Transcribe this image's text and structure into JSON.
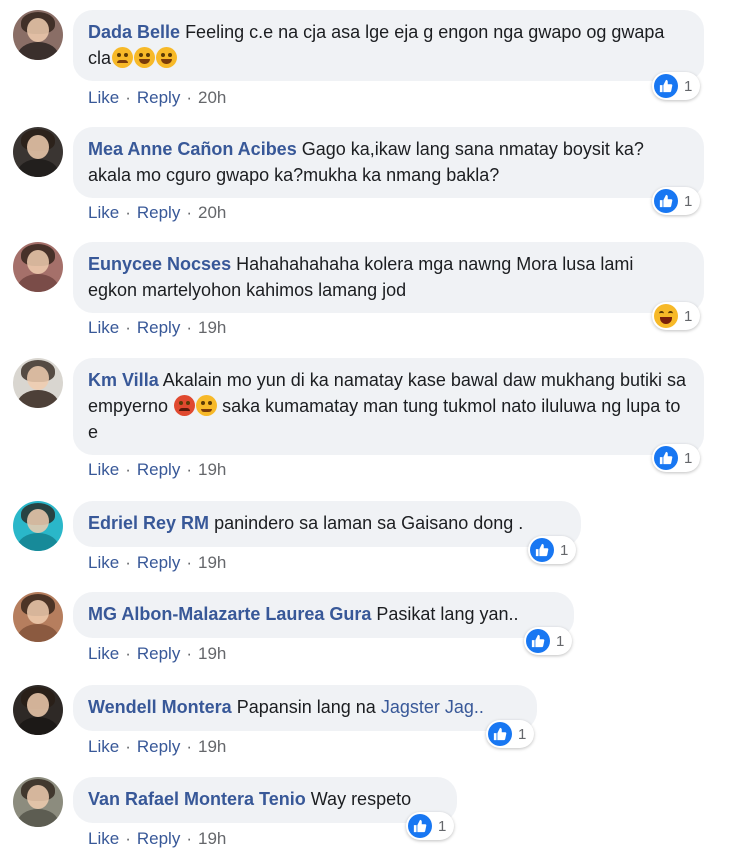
{
  "actions": {
    "like": "Like",
    "reply": "Reply",
    "separator": "·"
  },
  "colors": {
    "author": "#385898",
    "bubble": "#f0f2f5",
    "like_blue": "#1877f2",
    "haha_yellow": "#f7b928"
  },
  "comments": [
    {
      "author": "Dada Belle",
      "text_parts": [
        "Feeling c.e na cja asa lge eja g engon nga gwapo og gwapa cla"
      ],
      "emojis": [
        "worried-face-emoji",
        "laughing-face-emoji",
        "laughing-face-emoji"
      ],
      "time": "20h",
      "reaction": {
        "icon": "like-icon",
        "count": "1"
      },
      "avatar_colors": {
        "bg": "#8a6e66",
        "shirt": "#3a2f2c"
      }
    },
    {
      "author": "Mea Anne Cañon Acibes",
      "text_parts": [
        "Gago ka,ikaw lang sana nmatay boysit ka?akala mo cguro gwapo ka?mukha ka nmang bakla?"
      ],
      "time": "20h",
      "reaction": {
        "icon": "like-icon",
        "count": "1"
      },
      "avatar_colors": {
        "bg": "#3a3532",
        "shirt": "#221f1d"
      }
    },
    {
      "author": "Eunycee Nocses",
      "text_parts": [
        "Hahahahahaha kolera mga nawng Mora lusa lami egkon martelyohon kahimos lamang jod"
      ],
      "time": "19h",
      "reaction": {
        "icon": "haha-icon",
        "count": "1"
      },
      "avatar_colors": {
        "bg": "#a5706a",
        "shirt": "#7a4c48"
      }
    },
    {
      "author": "Km Villa",
      "text_parts": [
        "Akalain mo yun di ka namatay kase bawal daw mukhang butiki sa empyerno",
        "saka kumamatay man tung tukmol nato iluluwa ng lupa to e"
      ],
      "emojis": [
        "angry-face-emoji",
        "smirk-face-emoji"
      ],
      "time": "19h",
      "reaction": {
        "icon": "like-icon",
        "count": "1"
      },
      "avatar_colors": {
        "bg": "#d9d6d0",
        "shirt": "#4d4038"
      }
    },
    {
      "author": "Edriel Rey RM",
      "text_parts": [
        "panindero sa laman sa Gaisano dong ."
      ],
      "time": "19h",
      "reaction": {
        "icon": "like-icon",
        "count": "1"
      },
      "avatar_colors": {
        "bg": "#2ab7c9",
        "shirt": "#178a99"
      }
    },
    {
      "author": "MG Albon-Malazarte Laurea Gura",
      "text_parts": [
        "Pasikat lang yan.."
      ],
      "time": "19h",
      "reaction": {
        "icon": "like-icon",
        "count": "1"
      },
      "avatar_colors": {
        "bg": "#b67e5e",
        "shirt": "#8b5a40"
      }
    },
    {
      "author": "Wendell Montera",
      "text_parts": [
        "Papansin lang na"
      ],
      "mention": "Jagster Jag..",
      "time": "19h",
      "reaction": {
        "icon": "like-icon",
        "count": "1"
      },
      "avatar_colors": {
        "bg": "#2e2926",
        "shirt": "#1c1917"
      }
    },
    {
      "author": "Van Rafael Montera Tenio",
      "text_parts": [
        "Way respeto"
      ],
      "time": "19h",
      "reaction": {
        "icon": "like-icon",
        "count": "1"
      },
      "avatar_colors": {
        "bg": "#8c8c7e",
        "shirt": "#5d5d52"
      }
    }
  ]
}
